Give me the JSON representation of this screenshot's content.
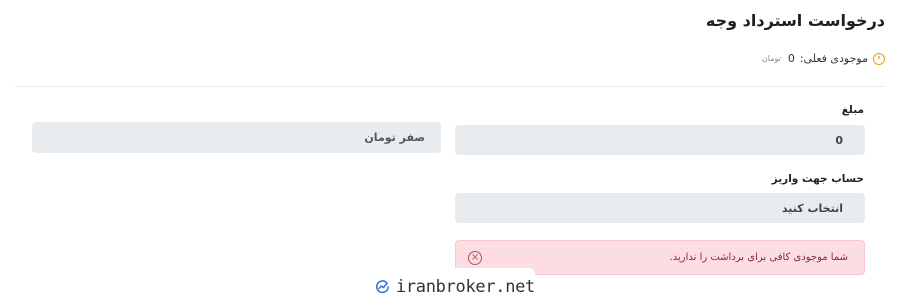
{
  "header": {
    "title": "درخواست استرداد وجه"
  },
  "balance": {
    "label": "موجودی فعلی:",
    "value": "0",
    "unit": "تومان"
  },
  "form": {
    "amount": {
      "label": "مبلغ",
      "value": "0",
      "in_words": "صفر تومان"
    },
    "account": {
      "label": "حساب جهت واریز",
      "placeholder": "انتخاب کنید"
    }
  },
  "alert": {
    "message": "شما موجودی کافی برای برداشت را ندارید."
  },
  "watermark": {
    "text": "iranbroker.net"
  },
  "colors": {
    "accent": "#e59f1e",
    "alert_bg": "#fcdde2",
    "alert_text": "#8a2a35",
    "input_bg": "#e9ecef",
    "logo_blue": "#2f6fd8"
  }
}
